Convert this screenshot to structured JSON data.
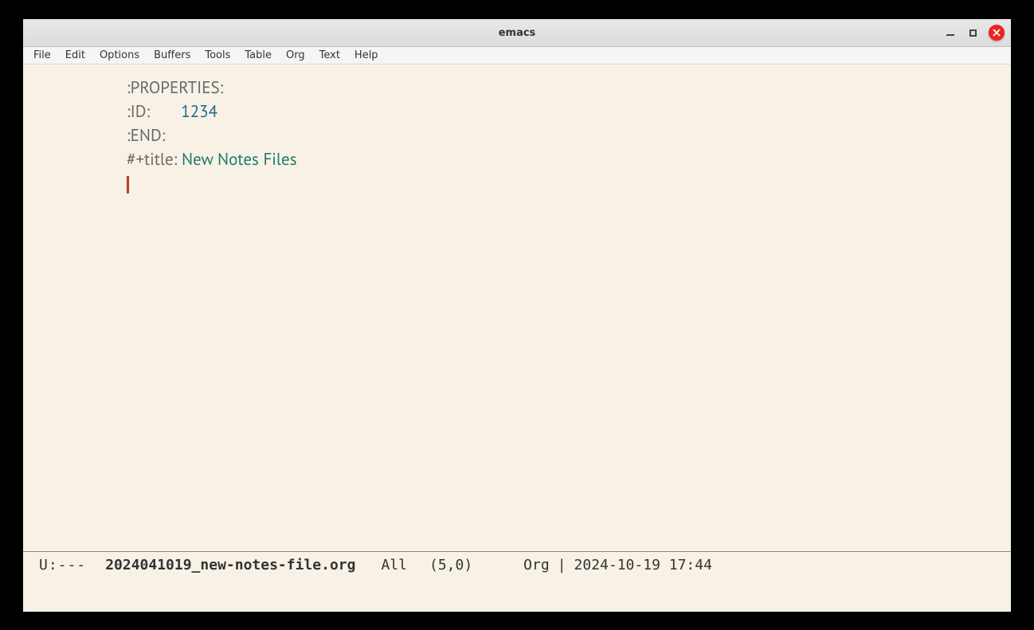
{
  "window": {
    "title": "emacs"
  },
  "menubar": {
    "items": [
      "File",
      "Edit",
      "Options",
      "Buffers",
      "Tools",
      "Table",
      "Org",
      "Text",
      "Help"
    ]
  },
  "editor": {
    "lines": {
      "properties_open": ":PROPERTIES:",
      "id_key": ":ID:",
      "id_value": "1234",
      "properties_close": ":END:",
      "title_keyword": "#+title:",
      "title_value": "New Notes Files"
    }
  },
  "modeline": {
    "modified": "U:---",
    "buffer_name": "2024041019_new-notes-file.org",
    "position": "All",
    "row_col": "(5,0)",
    "mode": "Org",
    "separator": "|",
    "datetime": "2024-10-19 17:44"
  }
}
